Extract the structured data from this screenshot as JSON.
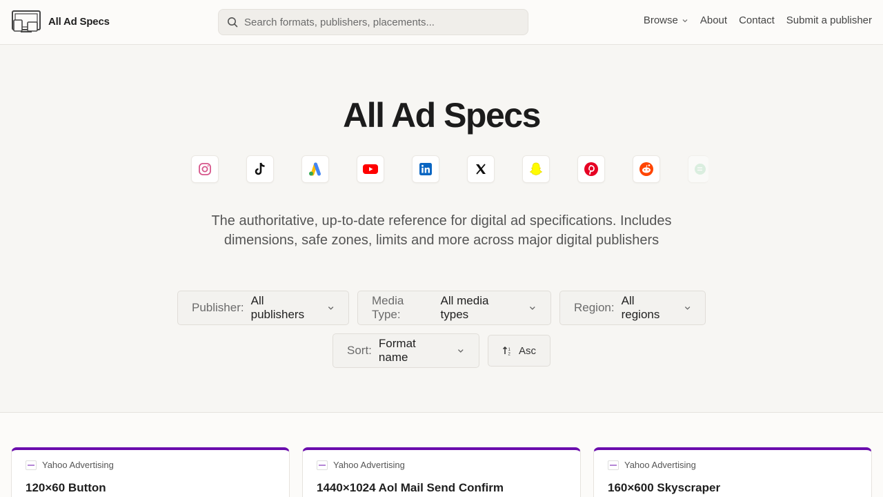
{
  "header": {
    "logo_text": "All Ad Specs",
    "search_placeholder": "Search formats, publishers, placements...",
    "nav": {
      "browse": "Browse",
      "about": "About",
      "contact": "Contact",
      "submit": "Submit a publisher"
    }
  },
  "hero": {
    "title": "All Ad Specs",
    "publisher_icons": [
      "instagram-icon",
      "tiktok-icon",
      "google-ads-icon",
      "youtube-icon",
      "linkedin-icon",
      "x-icon",
      "snapchat-icon",
      "pinterest-icon",
      "reddit-icon",
      "partial-green-icon"
    ],
    "tagline": "The authoritative, up-to-date reference for digital ad specifications. Includes dimensions, safe zones, limits and more across major digital publishers"
  },
  "filters": {
    "publisher": {
      "label": "Publisher:",
      "value": "All publishers"
    },
    "media_type": {
      "label": "Media Type:",
      "value": "All media types"
    },
    "region": {
      "label": "Region:",
      "value": "All regions"
    },
    "sort": {
      "label": "Sort:",
      "value": "Format name"
    },
    "order": "Asc"
  },
  "cards": [
    {
      "publisher": "Yahoo Advertising",
      "title": "120×60 Button"
    },
    {
      "publisher": "Yahoo Advertising",
      "title": "1440×1024 Aol Mail Send Confirm"
    },
    {
      "publisher": "Yahoo Advertising",
      "title": "160×600 Skyscraper"
    }
  ],
  "colors": {
    "accent": "#6a0dad",
    "background": "#f7f6f3"
  }
}
